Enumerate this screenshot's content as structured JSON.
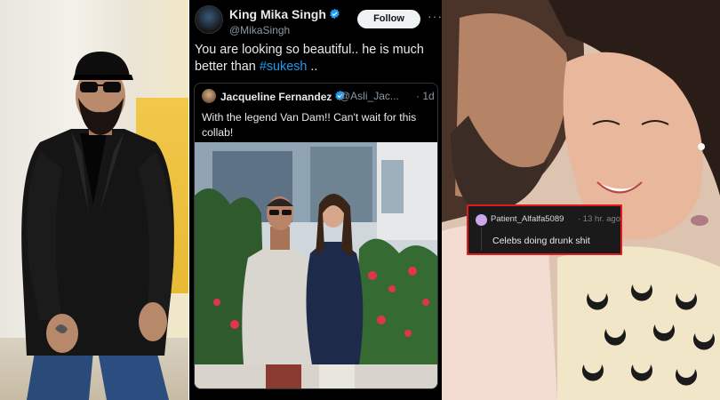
{
  "tweet": {
    "display_name": "King Mika Singh",
    "handle": "@MikaSingh",
    "follow_label": "Follow",
    "more_label": "···",
    "text_prefix": "You are looking so beautiful.. he is much better than ",
    "hashtag": "#sukesh",
    "text_suffix": " ..",
    "verified_color": "#1d9bf0",
    "quoted": {
      "display_name": "Jacqueline Fernandez",
      "handle": "@Asli_Jac...",
      "time": "· 1d",
      "text": "With the legend Van Dam!! Can't wait for this collab!"
    }
  },
  "comment": {
    "username": "Patient_Alfalfa5089",
    "time": "· 13 hr. ago",
    "text": "Celebs doing drunk shit",
    "border_color": "#e01b1b"
  }
}
